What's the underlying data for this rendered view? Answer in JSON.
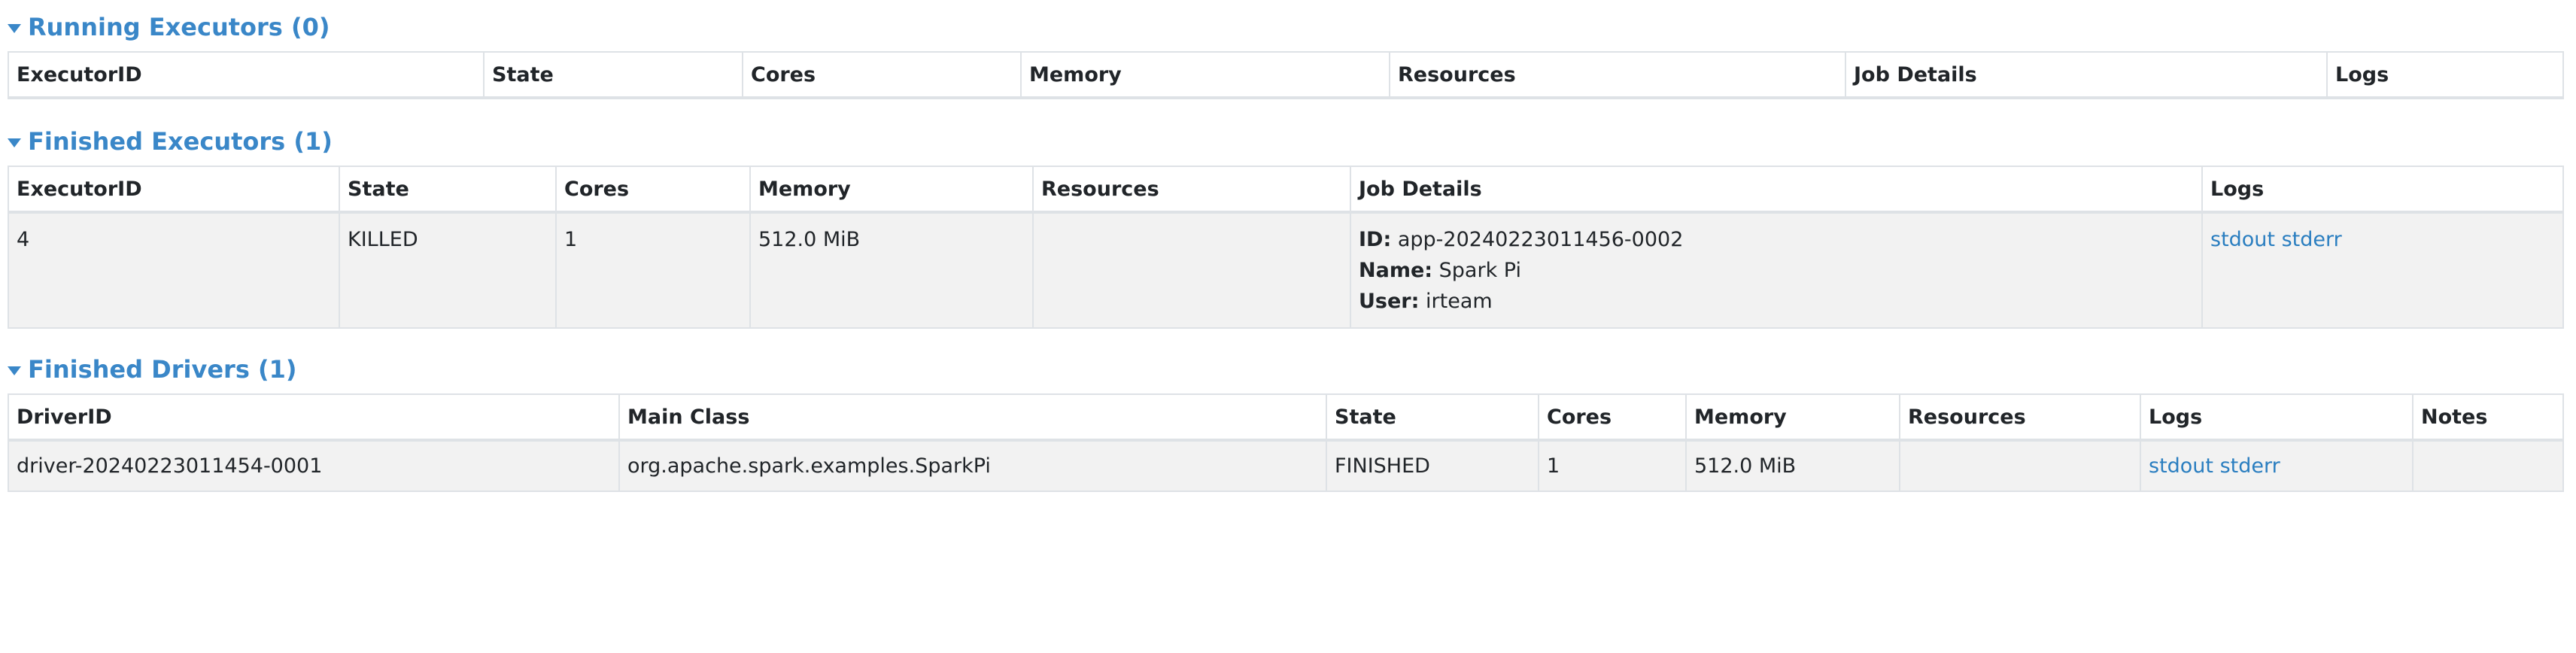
{
  "running_executors": {
    "title": "Running Executors (0)",
    "columns": [
      "ExecutorID",
      "State",
      "Cores",
      "Memory",
      "Resources",
      "Job Details",
      "Logs"
    ]
  },
  "finished_executors": {
    "title": "Finished Executors (1)",
    "columns": [
      "ExecutorID",
      "State",
      "Cores",
      "Memory",
      "Resources",
      "Job Details",
      "Logs"
    ],
    "rows": [
      {
        "executor_id": "4",
        "state": "KILLED",
        "cores": "1",
        "memory": "512.0 MiB",
        "resources": "",
        "job_id_label": "ID:",
        "job_id": "app-20240223011456-0002",
        "job_name_label": "Name:",
        "job_name": "Spark Pi",
        "job_user_label": "User:",
        "job_user": "irteam",
        "stdout": "stdout",
        "stderr": "stderr"
      }
    ]
  },
  "finished_drivers": {
    "title": "Finished Drivers (1)",
    "columns": [
      "DriverID",
      "Main Class",
      "State",
      "Cores",
      "Memory",
      "Resources",
      "Logs",
      "Notes"
    ],
    "rows": [
      {
        "driver_id": "driver-20240223011454-0001",
        "main_class": "org.apache.spark.examples.SparkPi",
        "state": "FINISHED",
        "cores": "1",
        "memory": "512.0 MiB",
        "resources": "",
        "stdout": "stdout",
        "stderr": "stderr",
        "notes": ""
      }
    ]
  },
  "colors": {
    "header_link": "#3a87c8",
    "log_link": "#2a7ec0",
    "row_bg": "#f2f2f2",
    "border": "#dee2e6"
  }
}
